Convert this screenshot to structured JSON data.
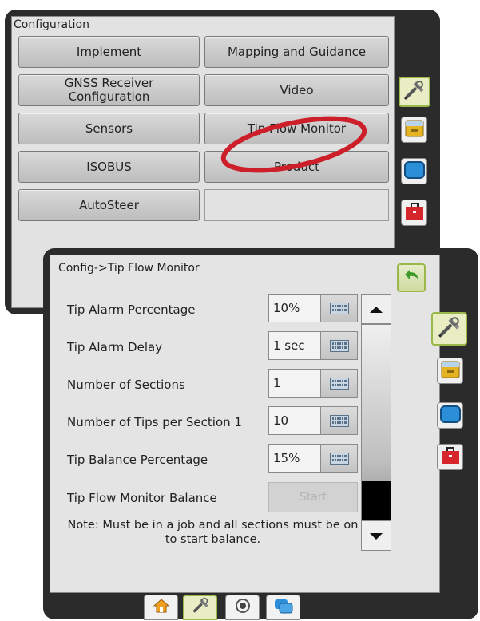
{
  "back_panel": {
    "title": "Configuration",
    "buttons": {
      "implement": "Implement",
      "mapping": "Mapping and Guidance",
      "gnss": "GNSS Receiver Configuration",
      "video": "Video",
      "sensors": "Sensors",
      "tip_flow": "Tip Flow Monitor",
      "isobus": "ISOBUS",
      "product": "Product",
      "autosteer": "AutoSteer"
    },
    "side_tabs": [
      "tools-icon",
      "drawer-icon",
      "screen-icon",
      "toolbox-icon"
    ]
  },
  "front_panel": {
    "breadcrumb": "Config->Tip Flow Monitor",
    "rows": [
      {
        "label": "Tip Alarm Percentage",
        "value": "10%"
      },
      {
        "label": "Tip Alarm Delay",
        "value": "1 sec"
      },
      {
        "label": "Number of Sections",
        "value": "1"
      },
      {
        "label": "Number of Tips per Section 1",
        "value": "10"
      },
      {
        "label": "Tip Balance Percentage",
        "value": "15%"
      }
    ],
    "balance_label": "Tip Flow Monitor Balance",
    "start_label": "Start",
    "note": "Note: Must be in a job and all sections must be on to start balance.",
    "bottom_tabs": [
      "home-icon",
      "tools-icon",
      "gnss-icon",
      "data-icon"
    ]
  },
  "colors": {
    "highlight_circle": "#cc1f2a",
    "active_tab": "#9ab84a"
  }
}
